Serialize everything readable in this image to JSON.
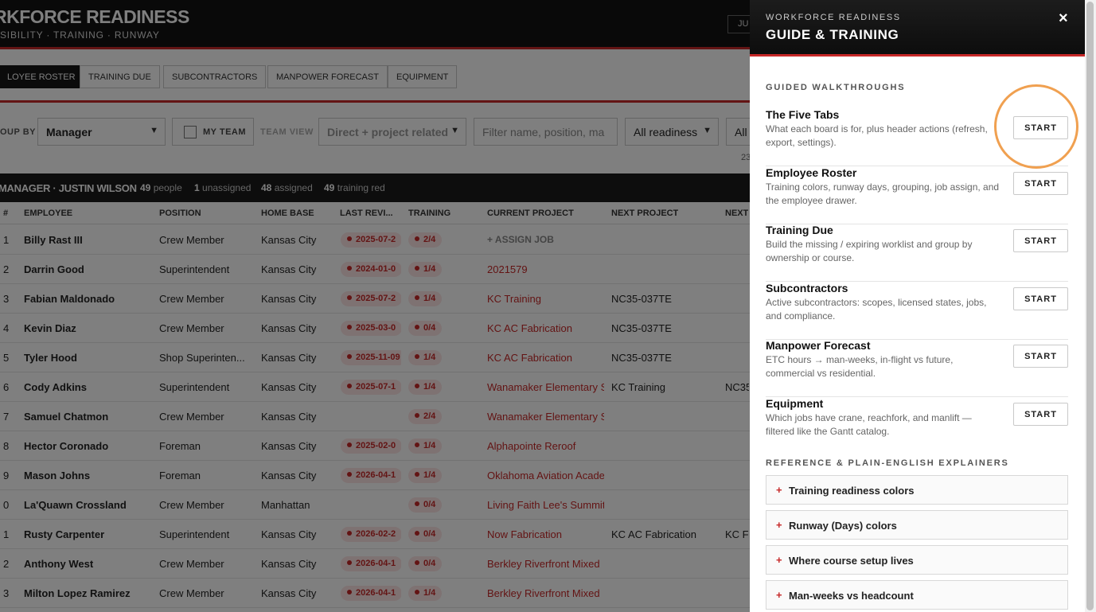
{
  "app": {
    "title": "RKFORCE READINESS",
    "subtitle": "SIBILITY · TRAINING · RUNWAY",
    "header_button": "JU"
  },
  "tabs": [
    "LOYEE ROSTER",
    "TRAINING DUE",
    "SUBCONTRACTORS",
    "MANPOWER FORECAST",
    "EQUIPMENT"
  ],
  "filters": {
    "group_by_label": "OUP BY",
    "group_by_value": "Manager",
    "my_team_label": "MY TEAM",
    "team_view_label": "TEAM VIEW",
    "team_view_value": "Direct + project related",
    "search_placeholder": "Filter name, position, ma",
    "readiness_value": "All readiness",
    "extra_value": "All",
    "count_fragment": "23"
  },
  "group_header": {
    "title": "MANAGER · JUSTIN WILSON",
    "people": "49",
    "people_label": "people",
    "unassigned": "1",
    "unassigned_label": "unassigned",
    "assigned": "48",
    "assigned_label": "assigned",
    "training_red": "49",
    "training_red_label": "training red"
  },
  "columns": {
    "num": "#",
    "employee": "EMPLOYEE",
    "position": "POSITION",
    "home_base": "HOME BASE",
    "last_review": "LAST REVI...",
    "training": "TRAINING",
    "current_project": "CURRENT PROJECT",
    "next_project": "NEXT PROJECT",
    "next2": "NEXT"
  },
  "rows": [
    {
      "num": "1",
      "name": "Billy Rast III",
      "position": "Crew Member",
      "home": "Kansas City",
      "review": "2025-07-2",
      "training": "2/4",
      "current": "+ ASSIGN JOB",
      "next": "",
      "next2": ""
    },
    {
      "num": "2",
      "name": "Darrin Good",
      "position": "Superintendent",
      "home": "Kansas City",
      "review": "2024-01-0",
      "training": "1/4",
      "current": "2021579",
      "next": "",
      "next2": ""
    },
    {
      "num": "3",
      "name": "Fabian Maldonado",
      "position": "Crew Member",
      "home": "Kansas City",
      "review": "2025-07-2",
      "training": "1/4",
      "current": "KC Training",
      "next": "NC35-037TE",
      "next2": ""
    },
    {
      "num": "4",
      "name": "Kevin Diaz",
      "position": "Crew Member",
      "home": "Kansas City",
      "review": "2025-03-0",
      "training": "0/4",
      "current": "KC AC Fabrication",
      "next": "NC35-037TE",
      "next2": ""
    },
    {
      "num": "5",
      "name": "Tyler Hood",
      "position": "Shop Superinten...",
      "home": "Kansas City",
      "review": "2025-11-09",
      "training": "1/4",
      "current": "KC AC Fabrication",
      "next": "NC35-037TE",
      "next2": ""
    },
    {
      "num": "6",
      "name": "Cody Adkins",
      "position": "Superintendent",
      "home": "Kansas City",
      "review": "2025-07-1",
      "training": "1/4",
      "current": "Wanamaker Elementary S",
      "next": "KC Training",
      "next2": "NC35"
    },
    {
      "num": "7",
      "name": "Samuel Chatmon",
      "position": "Crew Member",
      "home": "Kansas City",
      "review": "",
      "training": "2/4",
      "current": "Wanamaker Elementary S",
      "next": "",
      "next2": ""
    },
    {
      "num": "8",
      "name": "Hector Coronado",
      "position": "Foreman",
      "home": "Kansas City",
      "review": "2025-02-0",
      "training": "1/4",
      "current": "Alphapointe Reroof",
      "next": "",
      "next2": ""
    },
    {
      "num": "9",
      "name": "Mason Johns",
      "position": "Foreman",
      "home": "Kansas City",
      "review": "2026-04-1",
      "training": "1/4",
      "current": "Oklahoma Aviation Acade",
      "next": "",
      "next2": ""
    },
    {
      "num": "0",
      "name": "La'Quawn Crossland",
      "position": "Crew Member",
      "home": "Manhattan",
      "review": "",
      "training": "0/4",
      "current": "Living Faith Lee's Summit",
      "next": "",
      "next2": ""
    },
    {
      "num": "1",
      "name": "Rusty Carpenter",
      "position": "Superintendent",
      "home": "Kansas City",
      "review": "2026-02-2",
      "training": "0/4",
      "current": "Now Fabrication",
      "next": "KC AC Fabrication",
      "next2": "KC Fa"
    },
    {
      "num": "2",
      "name": "Anthony West",
      "position": "Crew Member",
      "home": "Kansas City",
      "review": "2026-04-1",
      "training": "0/4",
      "current": "Berkley Riverfront Mixed",
      "next": "",
      "next2": ""
    },
    {
      "num": "3",
      "name": "Milton Lopez Ramirez",
      "position": "Crew Member",
      "home": "Kansas City",
      "review": "2026-04-1",
      "training": "1/4",
      "current": "Berkley Riverfront Mixed",
      "next": "",
      "next2": ""
    }
  ],
  "drawer": {
    "kicker": "WORKFORCE READINESS",
    "title": "GUIDE & TRAINING",
    "close_label": "×",
    "walkthroughs_label": "GUIDED WALKTHROUGHS",
    "start_label": "START",
    "walkthroughs": [
      {
        "title": "The Five Tabs",
        "desc": "What each board is for, plus header actions (refresh, export, settings)."
      },
      {
        "title": "Employee Roster",
        "desc": "Training colors, runway days, grouping, job assign, and the employee drawer."
      },
      {
        "title": "Training Due",
        "desc": "Build the missing / expiring worklist and group by ownership or course."
      },
      {
        "title": "Subcontractors",
        "desc": "Active subcontractors: scopes, licensed states, jobs, and compliance."
      },
      {
        "title": "Manpower Forecast",
        "desc": "ETC hours → man-weeks, in-flight vs future, commercial vs residential."
      },
      {
        "title": "Equipment",
        "desc": "Which jobs have crane, reachfork, and manlift — filtered like the Gantt catalog."
      }
    ],
    "reference_label": "REFERENCE & PLAIN-ENGLISH EXPLAINERS",
    "reference": [
      "Training readiness colors",
      "Runway (Days) colors",
      "Where course setup lives",
      "Man-weeks vs headcount"
    ]
  },
  "colors": {
    "accent": "#c62828",
    "header_bg": "#121212",
    "highlight_ring": "#f0a050"
  }
}
